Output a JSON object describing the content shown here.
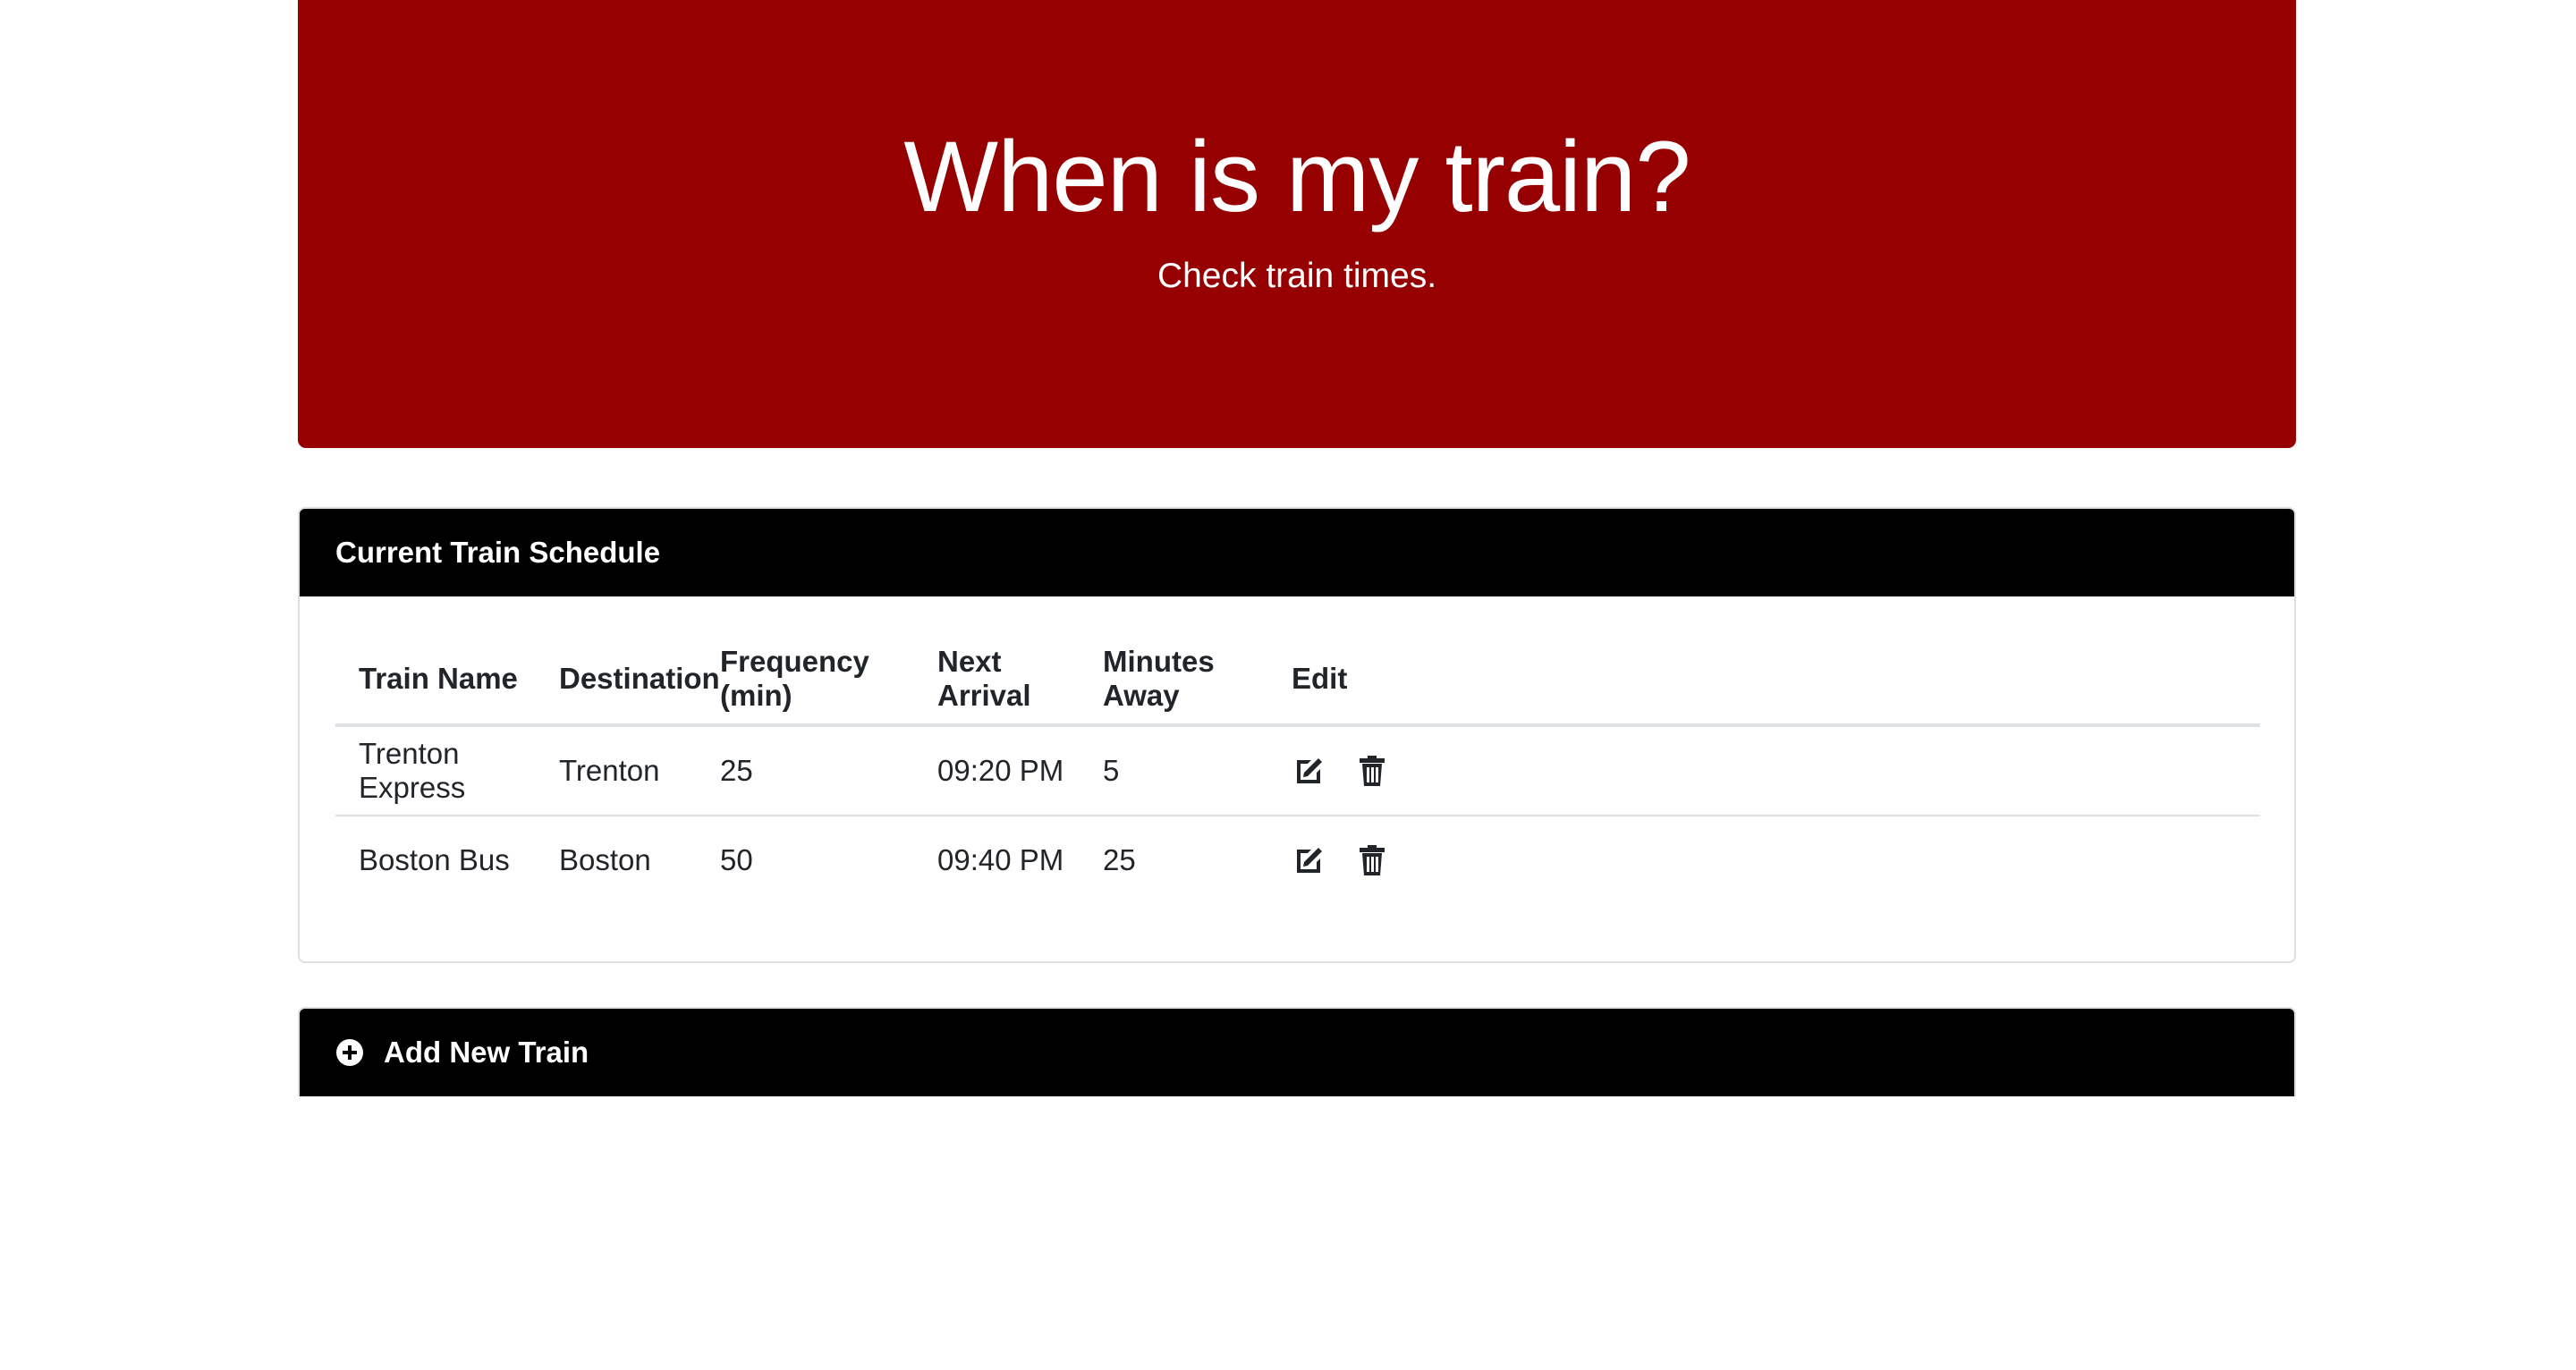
{
  "colors": {
    "jumbotron_bg": "#960000",
    "card_header_bg": "#000000"
  },
  "jumbotron": {
    "title": "When is my train?",
    "subtitle": "Check train times."
  },
  "schedule": {
    "header": "Current Train Schedule",
    "columns": [
      "Train Name",
      "Destination",
      "Frequency (min)",
      "Next Arrival",
      "Minutes Away",
      "Edit"
    ],
    "rows": [
      {
        "name": "Trenton Express",
        "destination": "Trenton",
        "frequency": "25",
        "next_arrival": "09:20 PM",
        "minutes_away": "5",
        "actions": [
          "edit-icon",
          "trash-icon"
        ]
      },
      {
        "name": "Boston Bus",
        "destination": "Boston",
        "frequency": "50",
        "next_arrival": "09:40 PM",
        "minutes_away": "25",
        "actions": [
          "edit-icon",
          "trash-icon"
        ]
      }
    ]
  },
  "add_train": {
    "header": "Add New Train",
    "icon": "plus-circle-icon"
  }
}
